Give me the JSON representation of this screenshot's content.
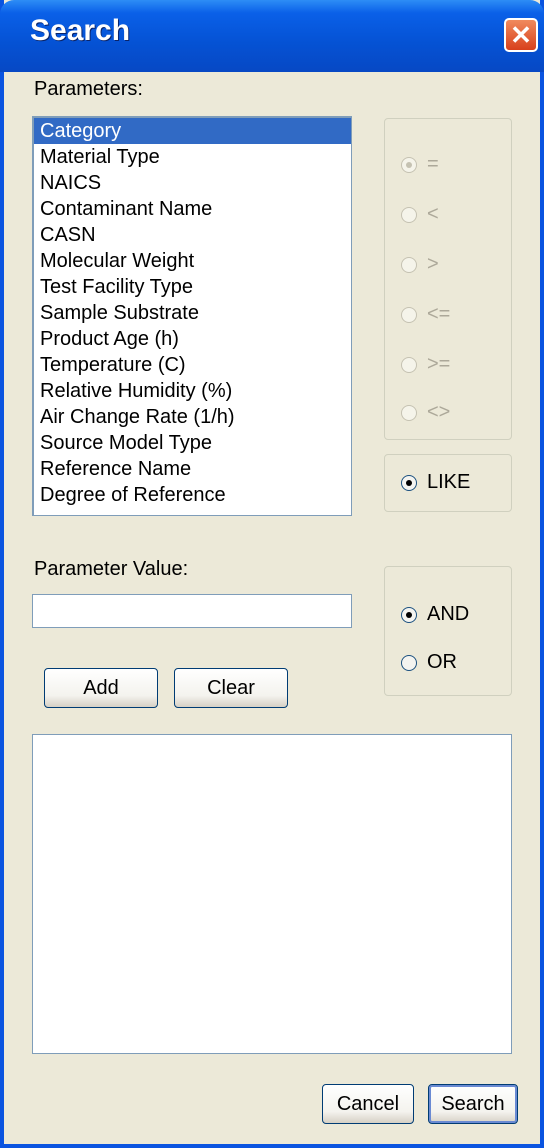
{
  "window": {
    "title": "Search",
    "close_glyph": "✕"
  },
  "parameters": {
    "label": "Parameters:",
    "items": [
      "Category",
      "Material Type",
      "NAICS",
      "Contaminant Name",
      "CASN",
      "Molecular Weight",
      "Test Facility Type",
      "Sample Substrate",
      "Product Age (h)",
      "Temperature (C)",
      "Relative Humidity (%)",
      "Air Change Rate (1/h)",
      "Source Model Type",
      "Reference Name",
      "Degree of Reference"
    ],
    "selected": "Category"
  },
  "operators": {
    "options": [
      "=",
      "<",
      ">",
      "<=",
      ">=",
      "<>"
    ],
    "like": "LIKE",
    "selected": "LIKE"
  },
  "value": {
    "label": "Parameter Value:",
    "current": ""
  },
  "logic": {
    "options": [
      "AND",
      "OR"
    ],
    "selected": "AND"
  },
  "buttons": {
    "add": "Add",
    "clear": "Clear",
    "cancel": "Cancel",
    "search": "Search"
  },
  "colors": {
    "title_bar": "#0552d4",
    "selection": "#316ac5",
    "dialog_bg": "#ece9d8",
    "close_button": "#d8401c"
  }
}
